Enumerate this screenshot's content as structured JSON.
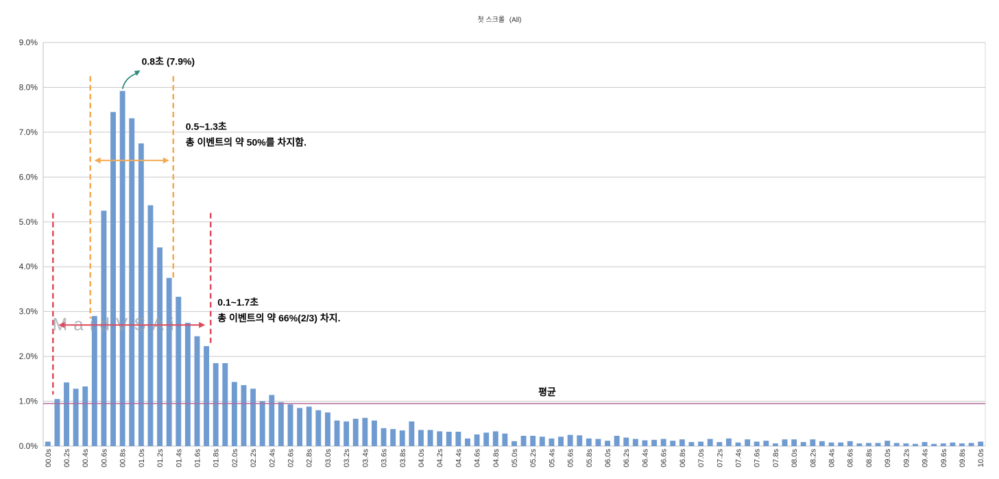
{
  "chart_data": {
    "type": "bar",
    "title": "첫 스크롤",
    "subtitle": "(All)",
    "ylim": [
      0,
      9
    ],
    "y_ticks": [
      "0.0%",
      "1.0%",
      "2.0%",
      "3.0%",
      "4.0%",
      "5.0%",
      "6.0%",
      "7.0%",
      "8.0%",
      "9.0%"
    ],
    "grid": true,
    "bar_color": "#6f9bd0",
    "categories": [
      "00.0s",
      "00.1s",
      "00.2s",
      "00.3s",
      "00.4s",
      "00.5s",
      "00.6s",
      "00.7s",
      "00.8s",
      "00.9s",
      "01.0s",
      "01.1s",
      "01.2s",
      "01.3s",
      "01.4s",
      "01.5s",
      "01.6s",
      "01.7s",
      "01.8s",
      "01.9s",
      "02.0s",
      "02.1s",
      "02.2s",
      "02.3s",
      "02.4s",
      "02.5s",
      "02.6s",
      "02.7s",
      "02.8s",
      "02.9s",
      "03.0s",
      "03.1s",
      "03.2s",
      "03.3s",
      "03.4s",
      "03.5s",
      "03.6s",
      "03.7s",
      "03.8s",
      "03.9s",
      "04.0s",
      "04.1s",
      "04.2s",
      "04.3s",
      "04.4s",
      "04.5s",
      "04.6s",
      "04.7s",
      "04.8s",
      "04.9s",
      "05.0s",
      "05.1s",
      "05.2s",
      "05.3s",
      "05.4s",
      "05.5s",
      "05.6s",
      "05.7s",
      "05.8s",
      "05.9s",
      "06.0s",
      "06.1s",
      "06.2s",
      "06.3s",
      "06.4s",
      "06.5s",
      "06.6s",
      "06.7s",
      "06.8s",
      "06.9s",
      "07.0s",
      "07.1s",
      "07.2s",
      "07.3s",
      "07.4s",
      "07.5s",
      "07.6s",
      "07.7s",
      "07.8s",
      "07.9s",
      "08.0s",
      "08.1s",
      "08.2s",
      "08.3s",
      "08.4s",
      "08.5s",
      "08.6s",
      "08.7s",
      "08.8s",
      "08.9s",
      "09.0s",
      "09.1s",
      "09.2s",
      "09.3s",
      "09.4s",
      "09.5s",
      "09.6s",
      "09.7s",
      "09.8s",
      "09.9s",
      "10.0s"
    ],
    "values": [
      0.1,
      1.05,
      1.42,
      1.28,
      1.33,
      2.9,
      5.25,
      7.45,
      7.92,
      7.31,
      6.75,
      5.37,
      4.43,
      3.75,
      3.33,
      2.75,
      2.45,
      2.23,
      1.85,
      1.85,
      1.43,
      1.36,
      1.28,
      1.0,
      1.14,
      0.98,
      0.93,
      0.85,
      0.88,
      0.8,
      0.75,
      0.57,
      0.55,
      0.61,
      0.63,
      0.57,
      0.4,
      0.38,
      0.35,
      0.55,
      0.36,
      0.36,
      0.33,
      0.32,
      0.32,
      0.17,
      0.26,
      0.3,
      0.33,
      0.28,
      0.11,
      0.23,
      0.23,
      0.21,
      0.17,
      0.21,
      0.25,
      0.24,
      0.17,
      0.16,
      0.12,
      0.23,
      0.19,
      0.16,
      0.13,
      0.14,
      0.16,
      0.12,
      0.15,
      0.09,
      0.1,
      0.16,
      0.09,
      0.17,
      0.08,
      0.15,
      0.1,
      0.12,
      0.06,
      0.15,
      0.15,
      0.09,
      0.15,
      0.11,
      0.08,
      0.08,
      0.11,
      0.06,
      0.07,
      0.07,
      0.12,
      0.07,
      0.06,
      0.05,
      0.09,
      0.05,
      0.06,
      0.08,
      0.06,
      0.07,
      0.1
    ],
    "average": {
      "label": "평균",
      "value": 0.95,
      "color": "#b06a9a"
    },
    "annotations": {
      "peak_label": "0.8초 (7.9%)",
      "orange_range_line1": "0.5~1.3초",
      "orange_range_line2": "총 이벤트의 약 50%를 차지함.",
      "red_range_line1": "0.1~1.7초",
      "red_range_line2": "총 이벤트의 약 66%(2/3) 차지.",
      "orange_color": "#f5a94f",
      "red_color": "#dd4a5d",
      "arrow_color": "#2e8b7a"
    },
    "watermark": "MaidVSAi"
  }
}
